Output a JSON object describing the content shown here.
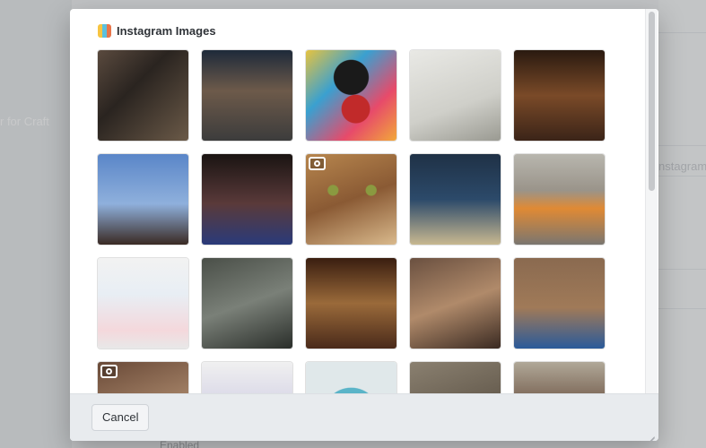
{
  "background": {
    "left_text": "r for Craft",
    "right_text": "nstagram",
    "bottom_text": "Enabled"
  },
  "modal": {
    "title": "Instagram Images",
    "title_icon": "instagram-color-icon",
    "images": [
      {
        "id": "img-1",
        "video": false,
        "bg": "linear-gradient(135deg,#5a4a3e 0%,#2a2420 40%,#6b5a48 100%)"
      },
      {
        "id": "img-2",
        "video": false,
        "bg": "linear-gradient(180deg,#1e2a3a 0%,#6d5a4a 45%,#3c3c3c 100%)"
      },
      {
        "id": "img-3",
        "video": false,
        "bg": "radial-gradient(circle at 55% 65%,#c12a2a 0 18%,transparent 19%),radial-gradient(circle at 50% 30%,#1a1a1a 0 22%,transparent 23%),linear-gradient(135deg,#e6c340 0%,#3aa0d0 35%,#e74a6a 70%,#f2a83a 100%)"
      },
      {
        "id": "img-4",
        "video": false,
        "bg": "linear-gradient(160deg,#e9e9e5 0%,#cfcfc9 60%,#9a9a92 100%)"
      },
      {
        "id": "img-5",
        "video": false,
        "bg": "linear-gradient(180deg,#2a1a10 0%,#7a4a28 50%,#3b2418 100%)"
      },
      {
        "id": "img-6",
        "video": false,
        "bg": "linear-gradient(180deg,#5a86c8 0%,#8fb0dc 55%,#3a2a24 100%)"
      },
      {
        "id": "img-7",
        "video": false,
        "bg": "linear-gradient(180deg,#1a1412 0%,#5a3a3a 55%,#2a3a7a 100%)"
      },
      {
        "id": "img-8",
        "video": true,
        "bg": "radial-gradient(circle at 30% 40%,#8a9a40 0 6%,transparent 7%),radial-gradient(circle at 72% 40%,#8a9a40 0 6%,transparent 7%),linear-gradient(160deg,#b7864e 0%,#8a5a34 50%,#d9b98c 100%)"
      },
      {
        "id": "img-9",
        "video": false,
        "bg": "linear-gradient(180deg,#1f3146 0%,#2c4a6a 50%,#c8b890 100%)"
      },
      {
        "id": "img-10",
        "video": false,
        "bg": "linear-gradient(180deg,#b8b6ae 0%,#9a948a 40%,#e08a34 60%,#7a7670 100%)"
      },
      {
        "id": "img-11",
        "video": false,
        "bg": "linear-gradient(180deg,#f2f2f2 0%,#e8eef4 40%,#f4d8dc 80%,#e8e8e8 100%)"
      },
      {
        "id": "img-12",
        "video": false,
        "bg": "linear-gradient(160deg,#4a4f48 0%,#7a8078 50%,#2a2e2a 100%)"
      },
      {
        "id": "img-13",
        "video": false,
        "bg": "linear-gradient(180deg,#3a1e10 0%,#9a6a3a 50%,#4a2a1a 100%)"
      },
      {
        "id": "img-14",
        "video": false,
        "bg": "linear-gradient(160deg,#6a5040 0%,#b08a6a 50%,#3a2a22 100%)"
      },
      {
        "id": "img-15",
        "video": false,
        "bg": "linear-gradient(180deg,#8a6a50 0%,#a07a58 55%,#2a5a9a 100%)"
      },
      {
        "id": "img-16",
        "video": true,
        "bg": "linear-gradient(160deg,#6a4a38 0%,#a8866a 60%,#4a3428 100%)"
      },
      {
        "id": "img-17",
        "video": false,
        "bg": "linear-gradient(180deg,#f0f0f0 0%,#d6d4e6 50%,#8a7ad0 100%)"
      },
      {
        "id": "img-18",
        "video": false,
        "bg": "radial-gradient(circle at 50% 60%,#3a3a3a 0 25%,#5ab4c8 26% 40%,#e0e8ea 41%)"
      },
      {
        "id": "img-19",
        "video": false,
        "bg": "linear-gradient(160deg,#8a8070 0%,#6a6052 50%,#a89a84 100%)"
      },
      {
        "id": "img-20",
        "video": false,
        "bg": "linear-gradient(180deg,#b0a898 0%,#6a5040 55%,#c8b8a0 100%)"
      }
    ],
    "cancel_label": "Cancel"
  },
  "colors": {
    "modal_bg": "#ffffff",
    "footer_bg": "#e8ebee",
    "title_text": "#2f3338"
  }
}
